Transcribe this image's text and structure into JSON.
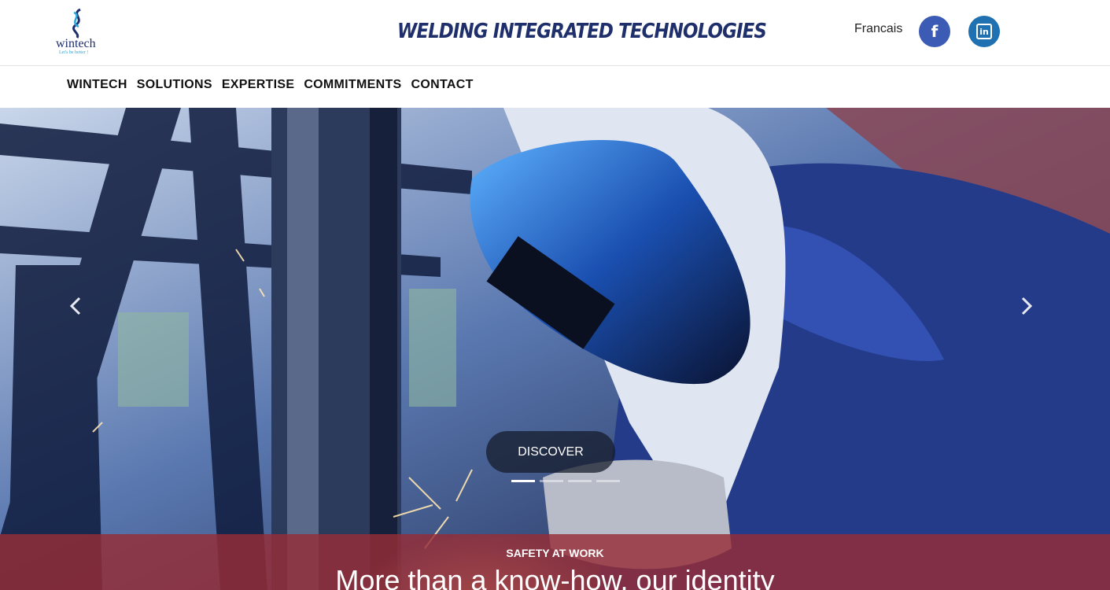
{
  "header": {
    "logo_name": "wintech",
    "logo_tagline": "Let's be better !",
    "title": "WELDING INTEGRATED TECHNOLOGIES",
    "language": "Francais",
    "social": {
      "facebook": "f",
      "linkedin": "in"
    }
  },
  "nav": {
    "items": [
      "WINTECH",
      "SOLUTIONS",
      "EXPERTISE",
      "COMMITMENTS",
      "CONTACT"
    ]
  },
  "hero": {
    "cta": "DISCOVER",
    "slides_count": 4,
    "active_slide": 1,
    "banner_kicker": "SAFETY AT WORK",
    "banner_headline": "More than a know-how, our identity"
  },
  "colors": {
    "brand": "#1f2f6b",
    "facebook": "#3b5bb5",
    "linkedin": "#1f71b2",
    "banner": "#962d37"
  },
  "icons": {
    "prev": "chevron-left-icon",
    "next": "chevron-right-icon"
  }
}
